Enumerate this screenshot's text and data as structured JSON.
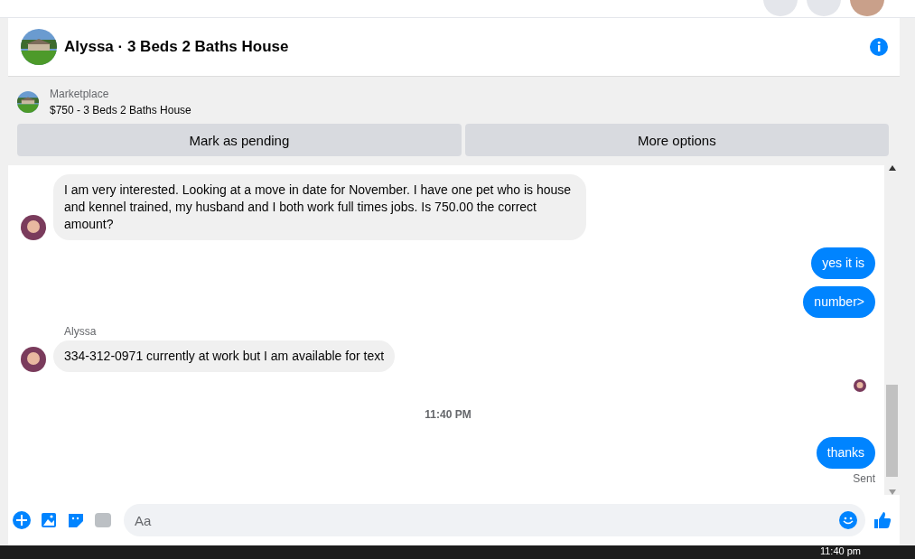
{
  "header": {
    "title": "Alyssa · 3 Beds 2 Baths House"
  },
  "listing": {
    "source": "Marketplace",
    "title": "$750 - 3 Beds 2 Baths House",
    "buttons": [
      "Mark as pending",
      "More options"
    ]
  },
  "messages": [
    {
      "kind": "incoming",
      "text": "I am very interested. Looking at a move in date for November. I have one pet who is house and kennel trained, my husband and I both work full times jobs. Is 750.00 the correct amount?"
    },
    {
      "kind": "outgoing",
      "text": "yes it is"
    },
    {
      "kind": "outgoing",
      "text": "number>"
    },
    {
      "kind": "incoming",
      "sender": "Alyssa",
      "text": "334-312-0971 currently at work but I am available for text"
    },
    {
      "kind": "seen"
    },
    {
      "kind": "time",
      "text": "11:40 PM"
    },
    {
      "kind": "outgoing",
      "text": "thanks",
      "status": "Sent"
    }
  ],
  "composer": {
    "placeholder": "Aa"
  },
  "taskbar": {
    "time": "11:40 pm"
  }
}
